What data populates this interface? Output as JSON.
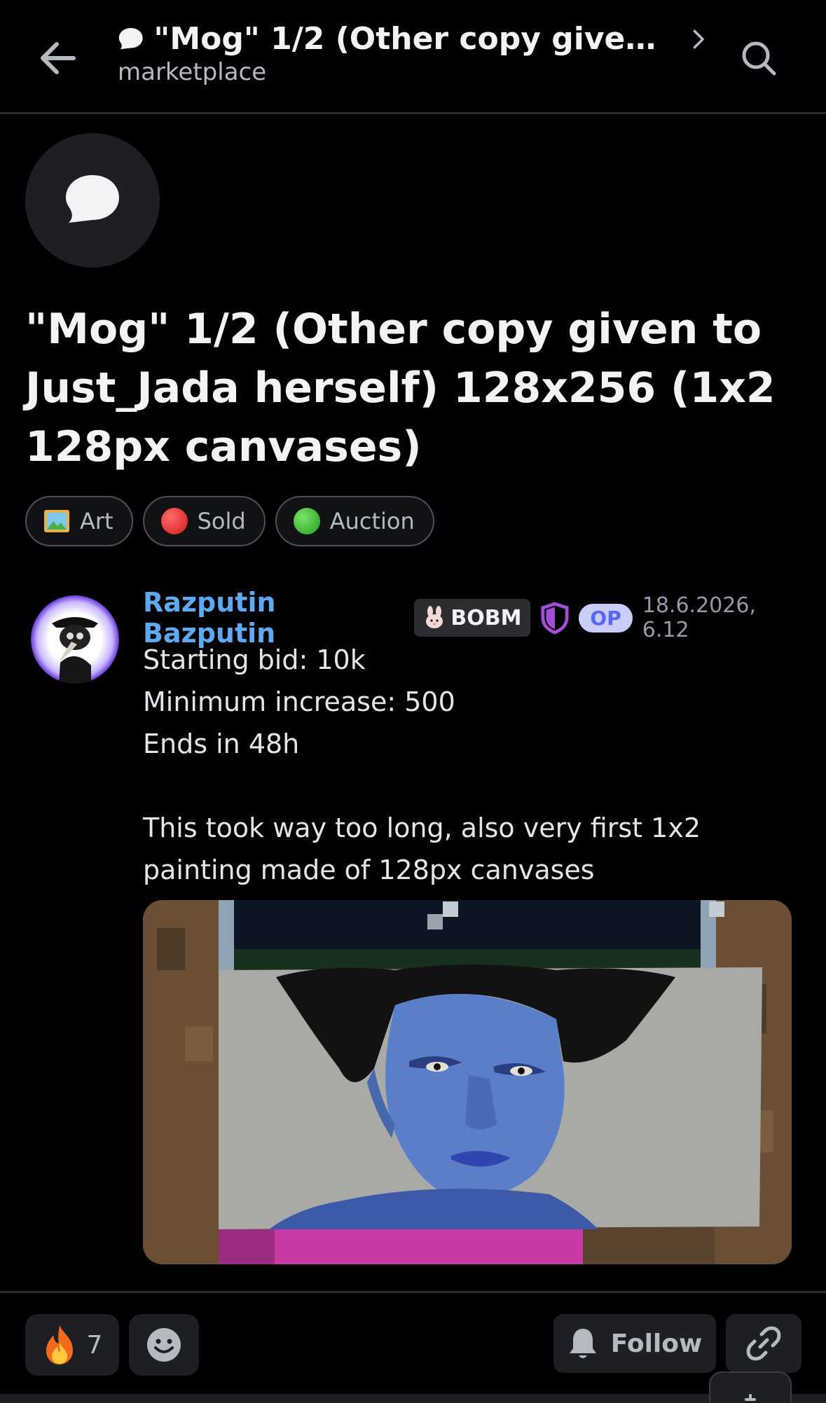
{
  "header": {
    "title": "\"Mog\" 1/2 (Other copy given to...",
    "subtitle": "marketplace"
  },
  "post": {
    "title": "\"Mog\" 1/2 (Other copy given to Just_Jada herself) 128x256 (1x2 128px canvases)",
    "tags": [
      {
        "label": "Art",
        "icon": "framed-picture-emoji"
      },
      {
        "label": "Sold",
        "icon": "red-circle",
        "color": "#e02b2b"
      },
      {
        "label": "Auction",
        "icon": "green-circle",
        "color": "#2fb52c"
      }
    ]
  },
  "message": {
    "author": "Razputin Bazputin",
    "clan_tag": "BOBM",
    "op_badge": "OP",
    "timestamp": "18.6.2026, 6.12",
    "body": "Starting bid: 10k\nMinimum increase: 500\nEnds in 48h\n\nThis took way too long, also very first 1x2 painting made of 128px canvases"
  },
  "footer": {
    "reaction_emoji": "fire",
    "reaction_count": "7",
    "follow_label": "Follow"
  },
  "colors": {
    "background": "#000000",
    "author": "#5ea9f2",
    "op_badge_bg": "#c9cdfb",
    "op_badge_text": "#5865f2",
    "shield": "#a24ed8"
  }
}
